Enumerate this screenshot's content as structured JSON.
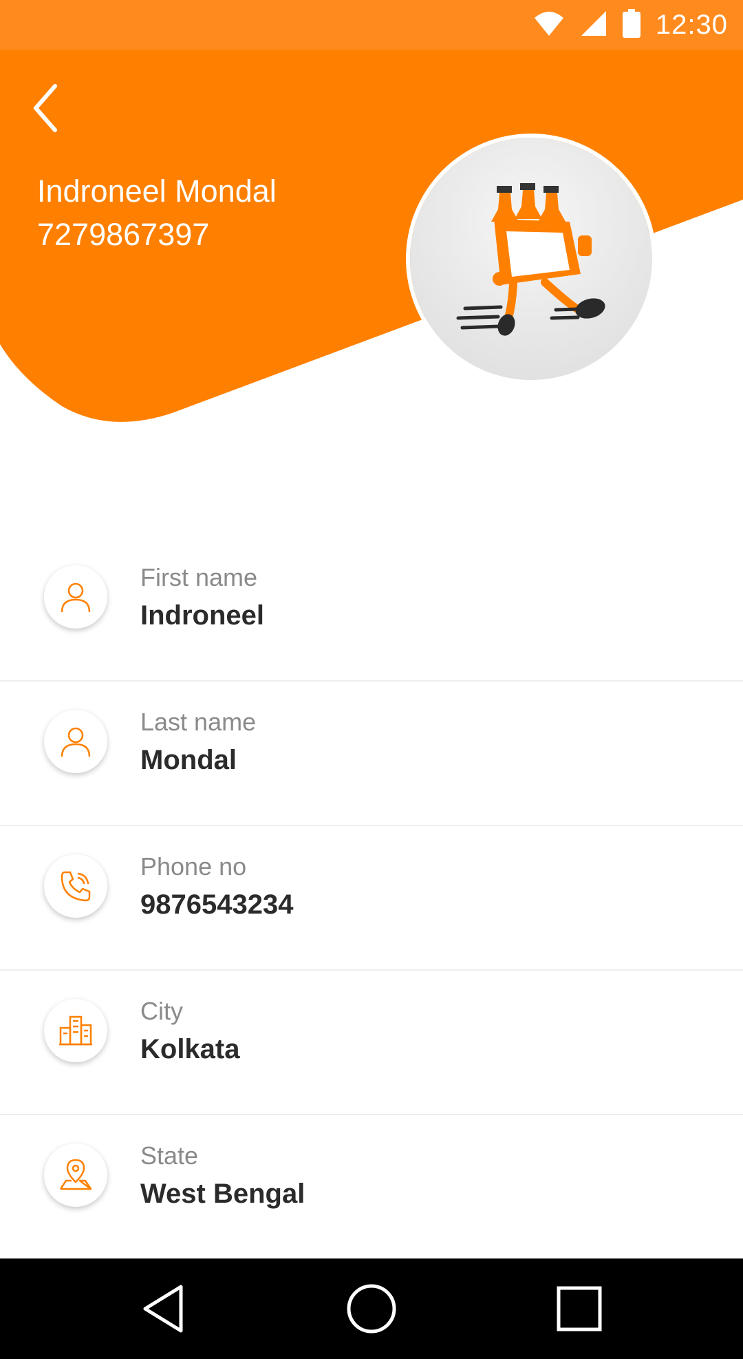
{
  "status_bar": {
    "time": "12:30",
    "icons": [
      "wifi-icon",
      "signal-icon",
      "battery-icon"
    ]
  },
  "header": {
    "back_icon": "back-arrow-icon",
    "name": "Indroneel Mondal",
    "phone": "7279867397",
    "avatar_icon": "delivery-runner-logo"
  },
  "details": [
    {
      "icon": "person-icon",
      "label": "First name",
      "value": "Indroneel"
    },
    {
      "icon": "person-icon",
      "label": "Last name",
      "value": "Mondal"
    },
    {
      "icon": "phone-icon",
      "label": "Phone no",
      "value": "9876543234"
    },
    {
      "icon": "building-icon",
      "label": "City",
      "value": "Kolkata"
    },
    {
      "icon": "location-pin-icon",
      "label": "State",
      "value": "West Bengal"
    }
  ],
  "nav_bar": {
    "icons": [
      "back-triangle-icon",
      "home-circle-icon",
      "recents-square-icon"
    ]
  },
  "colors": {
    "accent": "#ff8000",
    "status_bar": "#ff8b1f",
    "label": "#8a8a8a",
    "value": "#2b2b2b"
  }
}
